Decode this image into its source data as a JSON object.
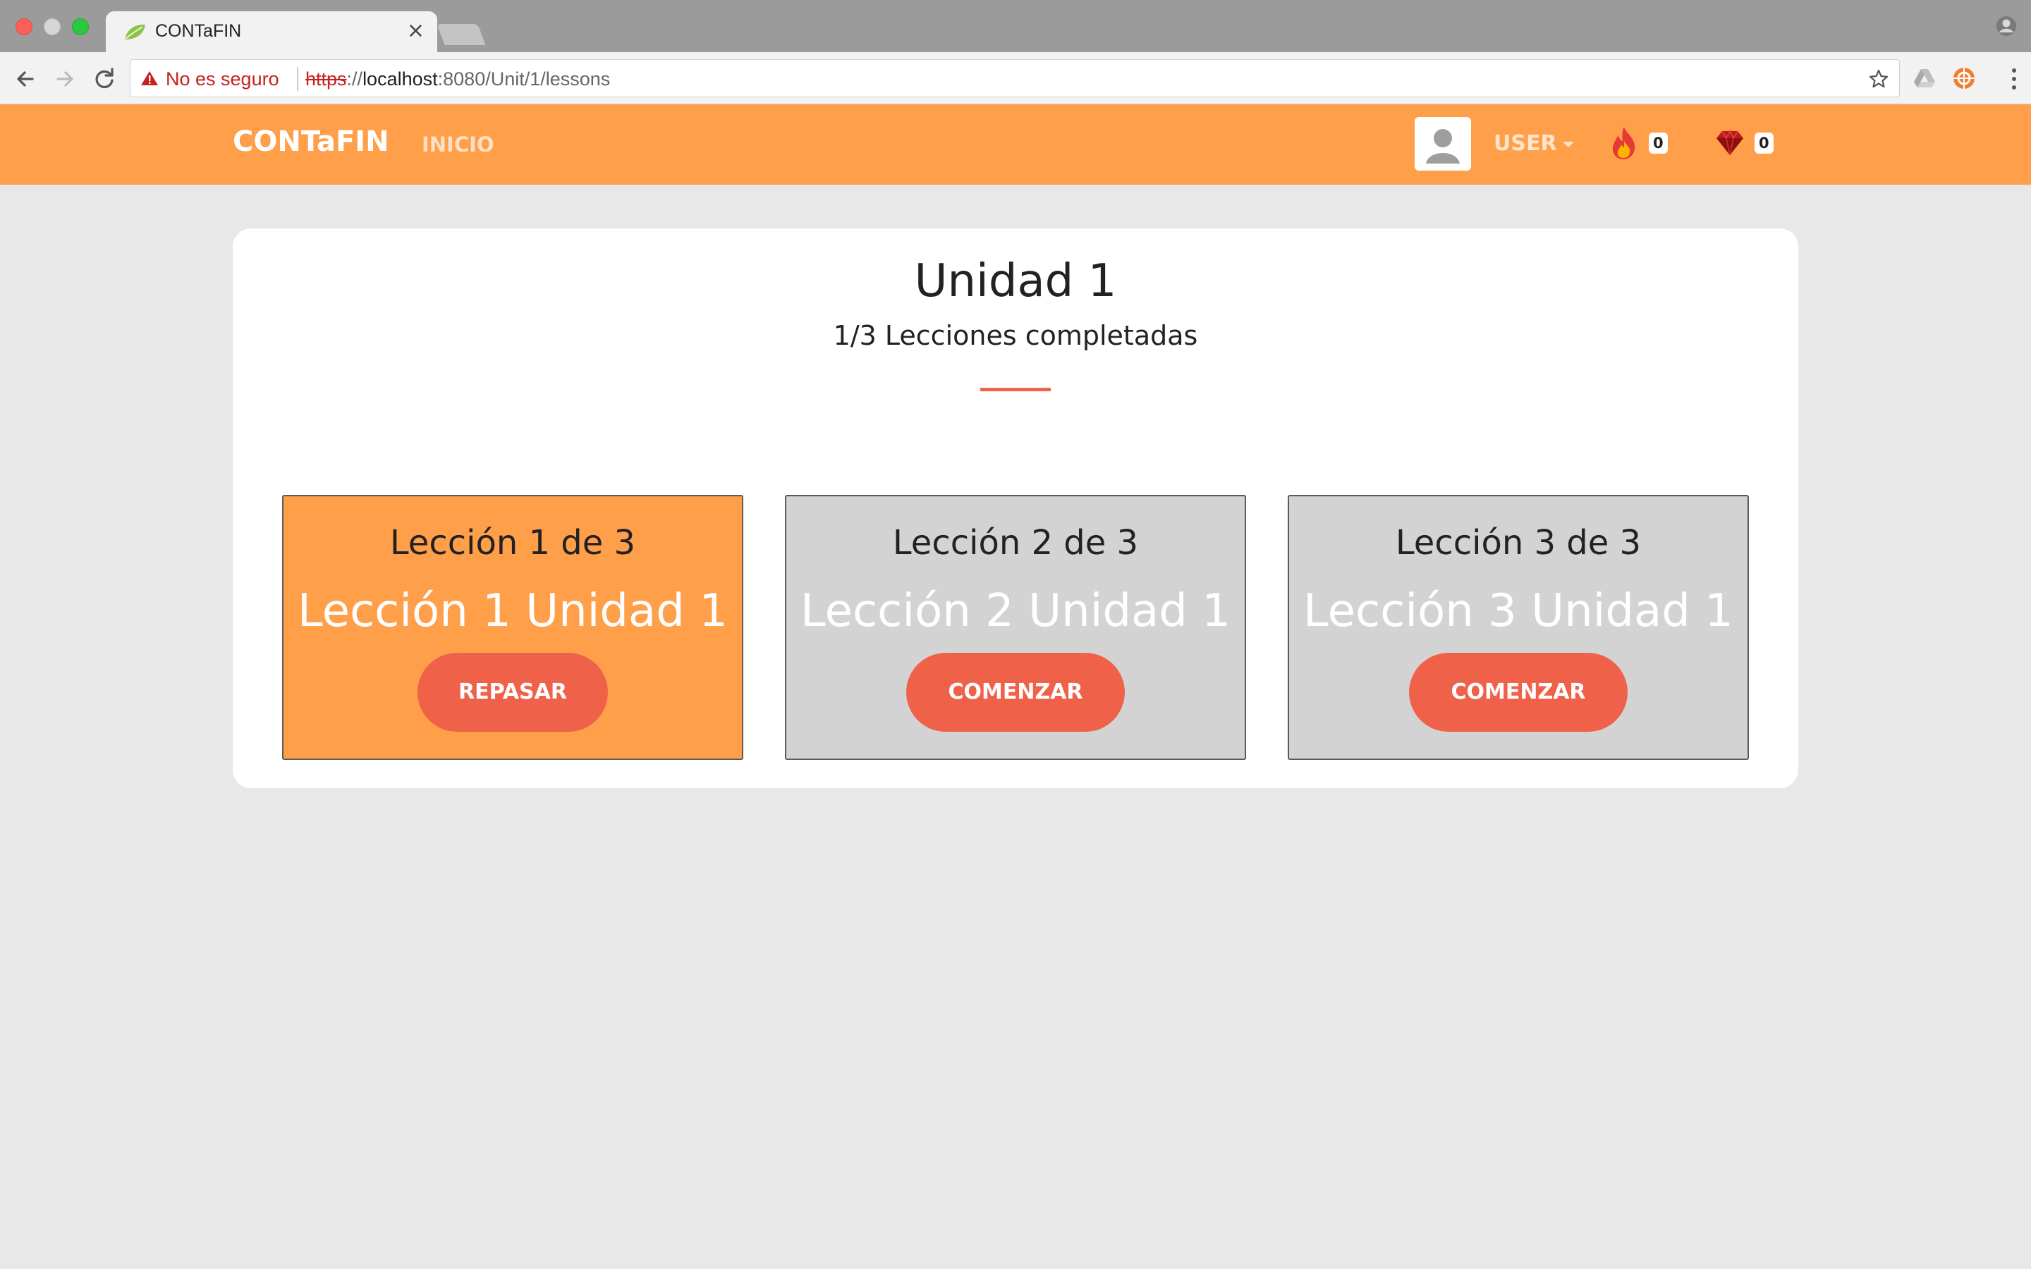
{
  "browser": {
    "tab_title": "CONTaFIN",
    "tab_close": "×",
    "security_label": "No es seguro",
    "url_scheme": "https",
    "url_sep": "://",
    "url_host": "localhost",
    "url_rest": ":8080/Unit/1/lessons"
  },
  "nav": {
    "brand": "CONTaFIN",
    "inicio": "INICIO",
    "user_label": "USER",
    "streak_count": "0",
    "gems_count": "0"
  },
  "unit": {
    "title": "Unidad 1",
    "progress": "1/3 Lecciones completadas"
  },
  "lessons": [
    {
      "number": "Lección 1 de 3",
      "name": "Lección 1 Unidad 1",
      "button": "REPASAR",
      "status": "completed"
    },
    {
      "number": "Lección 2 de 3",
      "name": "Lección 2 Unidad 1",
      "button": "COMENZAR",
      "status": "pending"
    },
    {
      "number": "Lección 3 de 3",
      "name": "Lección 3 Unidad 1",
      "button": "COMENZAR",
      "status": "pending"
    }
  ],
  "colors": {
    "nav_orange": "#ff9f4a",
    "accent_red": "#f0614a",
    "card_grey": "#d4d3d3",
    "page_bg": "#e8e8e8"
  }
}
